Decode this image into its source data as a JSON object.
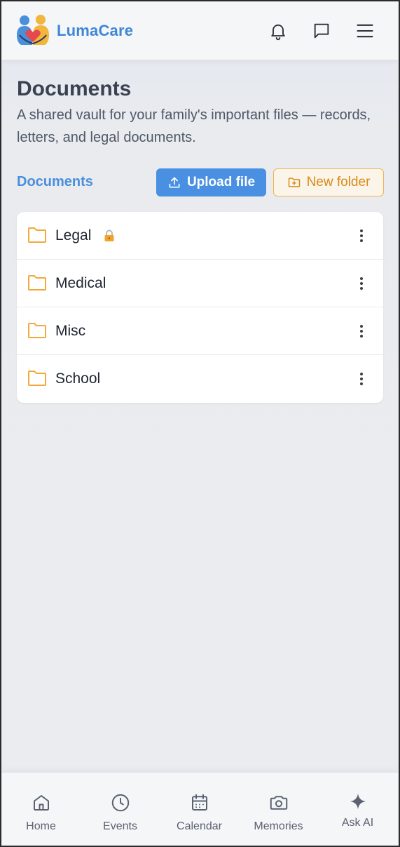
{
  "app": {
    "brand": "LumaCare",
    "colors": {
      "brand": "#3f86d6",
      "primary": "#4a90e2",
      "accent": "#f0a52a"
    }
  },
  "header": {
    "icons": [
      "notification-bell-icon",
      "messages-icon",
      "menu-icon"
    ]
  },
  "page": {
    "title": "Documents",
    "subtitle": "A shared vault for your family's important files — records, letters, and legal documents."
  },
  "toolbar": {
    "breadcrumb": "Documents",
    "upload_label": "Upload file",
    "new_folder_label": "New folder"
  },
  "folders": [
    {
      "name": "Legal",
      "locked": true
    },
    {
      "name": "Medical",
      "locked": false
    },
    {
      "name": "Misc",
      "locked": false
    },
    {
      "name": "School",
      "locked": false
    }
  ],
  "nav": [
    {
      "label": "Home",
      "icon": "home-icon"
    },
    {
      "label": "Events",
      "icon": "clock-icon"
    },
    {
      "label": "Calendar",
      "icon": "calendar-icon"
    },
    {
      "label": "Memories",
      "icon": "camera-icon"
    },
    {
      "label": "Ask AI",
      "icon": "sparkle-icon"
    }
  ]
}
